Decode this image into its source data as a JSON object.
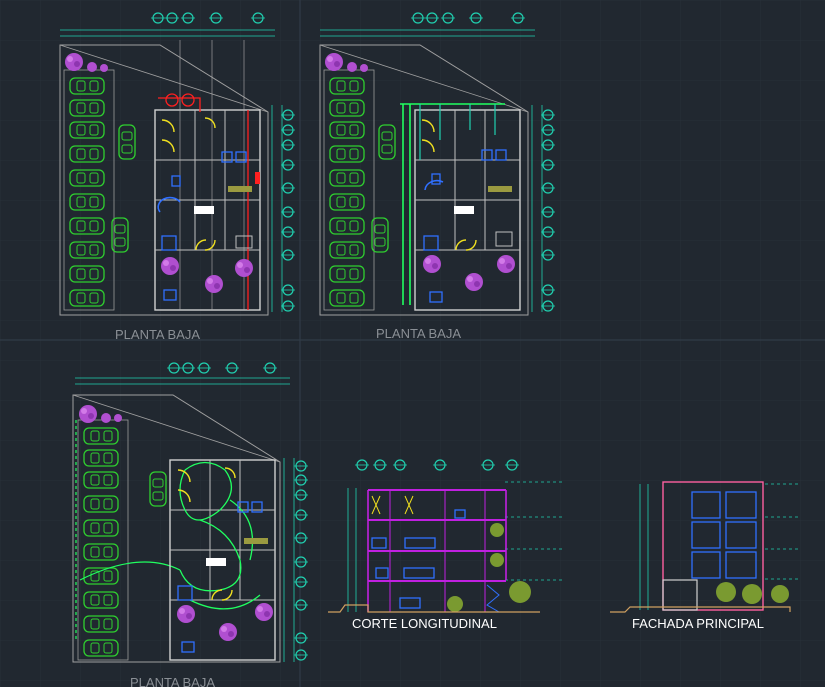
{
  "drawing": {
    "labels": {
      "plan_1": "PLANTA BAJA",
      "plan_2": "PLANTA BAJA",
      "plan_3": "PLANTA BAJA",
      "section": "CORTE LONGITUDINAL",
      "facade": "FACHADA PRINCIPAL"
    },
    "colors": {
      "background": "#212830",
      "grid": "#2c3540",
      "wall": "#c8c8c8",
      "parking": "#2fd02f",
      "trees": "#b04fd0",
      "doors": "#f0e020",
      "fixtures": "#3070ff",
      "dimensions": "#20d0b0",
      "elec_red": "#ff2020",
      "elec_green": "#20ff60",
      "section_frame": "#c020e0"
    }
  }
}
